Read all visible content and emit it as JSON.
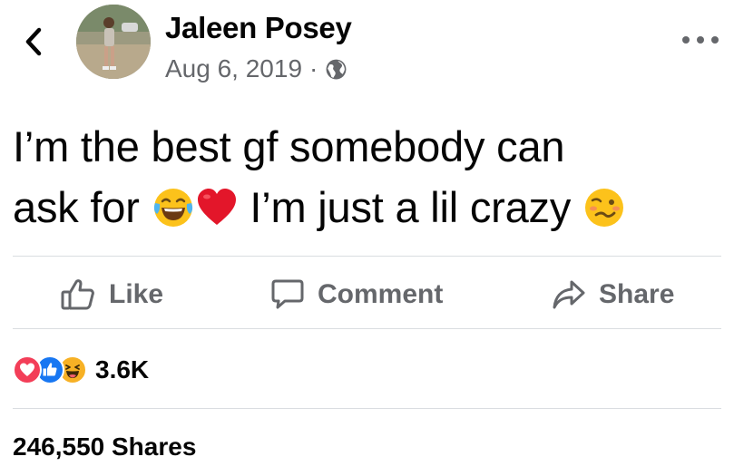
{
  "post": {
    "author": "Jaleen Posey",
    "date": "Aug 6, 2019",
    "separator": "·",
    "audience_icon": "globe-icon",
    "text_line1": "I’m the best gf somebody can",
    "text_line2_part1": "ask for ",
    "text_line2_part2": " I’m just a lil crazy ",
    "emojis": [
      "face-with-tears-of-joy",
      "red-heart",
      "woozy-face"
    ]
  },
  "actions": {
    "like_label": "Like",
    "comment_label": "Comment",
    "share_label": "Share"
  },
  "stats": {
    "reaction_icons": [
      "love",
      "like",
      "haha"
    ],
    "reactions_count": "3.6K",
    "shares_text": "246,550 Shares"
  },
  "colors": {
    "text": "#050505",
    "secondary_text": "#65676b",
    "divider": "#dadde1",
    "like_blue": "#1877f2",
    "love_red": "#f33e58",
    "haha_yellow": "#f7b125"
  }
}
